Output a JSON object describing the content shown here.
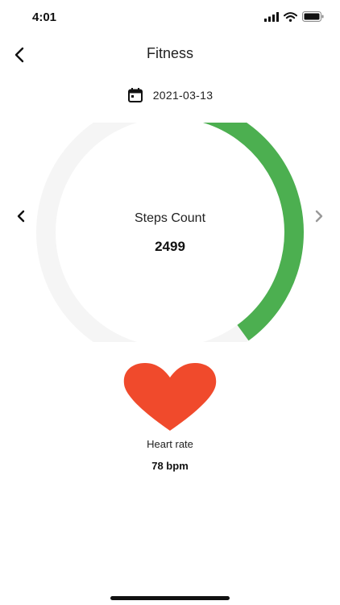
{
  "status_bar": {
    "time": "4:01",
    "icons": [
      "signal-icon",
      "wifi-icon",
      "battery-icon"
    ]
  },
  "header": {
    "title": "Fitness",
    "back_icon": "chevron-left-icon"
  },
  "date_selector": {
    "date": "2021-03-13",
    "icon": "calendar-icon"
  },
  "steps": {
    "label": "Steps Count",
    "value": "2499",
    "progress": 0.4,
    "prev_icon": "chevron-left-icon",
    "next_icon": "chevron-right-icon"
  },
  "heart": {
    "label": "Heart rate",
    "value": "78 bpm",
    "icon": "heart-icon"
  },
  "colors": {
    "progress": "#4caf50",
    "track": "#f5f5f5",
    "heart": "#f04a2c"
  }
}
